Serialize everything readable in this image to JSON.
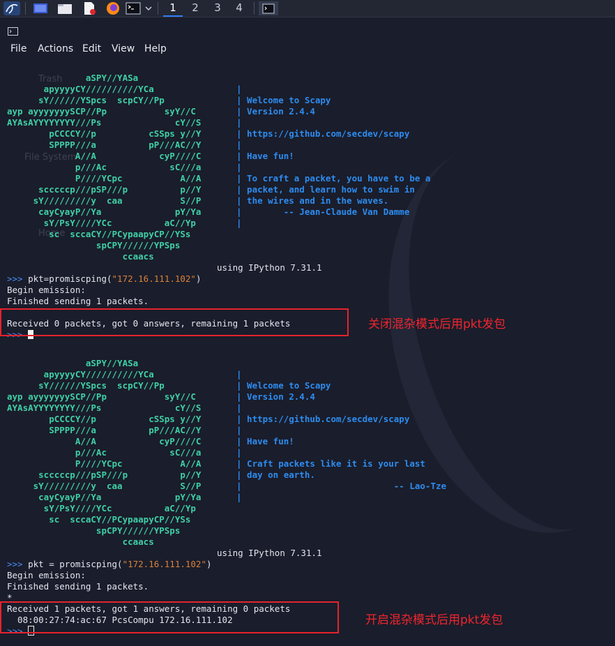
{
  "taskbar": {
    "icons": [
      "kali-dragon-icon",
      "show-desktop-icon",
      "file-manager-icon",
      "text-editor-icon",
      "firefox-icon",
      "terminal-icon",
      "chevron-down-icon",
      "terminal-window-icon"
    ],
    "workspaces": [
      "1",
      "2",
      "3",
      "4"
    ],
    "active_workspace": "1"
  },
  "menu": {
    "file": "File",
    "actions": "Actions",
    "edit": "Edit",
    "view": "View",
    "help": "Help"
  },
  "desktop_ghost": {
    "trash": "Trash",
    "filesystem": "File System",
    "home": "Home"
  },
  "ascii_art": "               aSPY//YASa\n       apyyyyCY//////////YCa\n      sY//////YSpcs  scpCY//Pp\nayp ayyyyyyySCP//Pp           syY//C\nAYAsAYYYYYYYY///Ps              cY//S\n        pCCCCY//p          cSSps y//Y\n        SPPPP///a          pP///AC//Y\n             A//A            cyP////C\n             p///Ac            sC///a\n             P////YCpc           A//A\n      scccccp///pSP///p          p//Y\n     sY/////////y  caa           S//P\n      cayCyayP//Ya              pY/Ya\n       sY/PsY////YCc          aC//Yp\n        sc  sccaCY//PCypaapyCP//YSs\n                 spCPY//////YPSps\n                      ccaacs",
  "session1": {
    "info": "|\n| Welcome to Scapy\n| Version 2.4.4\n|\n| https://github.com/secdev/scapy\n|\n| Have fun!\n|\n| To craft a packet, you have to be a\n| packet, and learn how to swim in\n| the wires and in the waves.\n|        -- Jean-Claude Van Damme\n|",
    "ipython": "                                        using IPython 7.31.1",
    "prompt": ">>> ",
    "cmd_prefix": "pkt=promiscping(",
    "cmd_arg": "\"172.16.111.102\"",
    "cmd_suffix": ")",
    "begin": "Begin emission:",
    "finished": "Finished sending 1 packets.",
    "received": "Received 0 packets, got 0 answers, remaining 1 packets",
    "annotation": "关闭混杂模式后用pkt发包"
  },
  "session2": {
    "info": "|\n| Welcome to Scapy\n| Version 2.4.4\n|\n| https://github.com/secdev/scapy\n|\n| Have fun!\n|\n| Craft packets like it is your last\n| day on earth.\n|                             -- Lao-Tze\n|",
    "ipython": "                                        using IPython 7.31.1",
    "prompt": ">>> ",
    "cmd_prefix": "pkt = promiscping(",
    "cmd_arg": "\"172.16.111.102\"",
    "cmd_suffix": ")",
    "begin": "Begin emission:",
    "finished": "Finished sending 1 packets.",
    "star": "*",
    "received": "Received 1 packets, got 1 answers, remaining 0 packets",
    "answer": "  08:00:27:74:ac:67 PcsCompu 172.16.111.102",
    "annotation": "开启混杂模式后用pkt发包"
  },
  "colors": {
    "background": "#1a1d2b",
    "ascii_art": "#3fd0a6",
    "info_text": "#2d8cf0",
    "prompt": "#4a8df5",
    "string_literal": "#d9823b",
    "annotation_red": "#e5232d",
    "taskbar_accent": "#2f7cf6"
  }
}
